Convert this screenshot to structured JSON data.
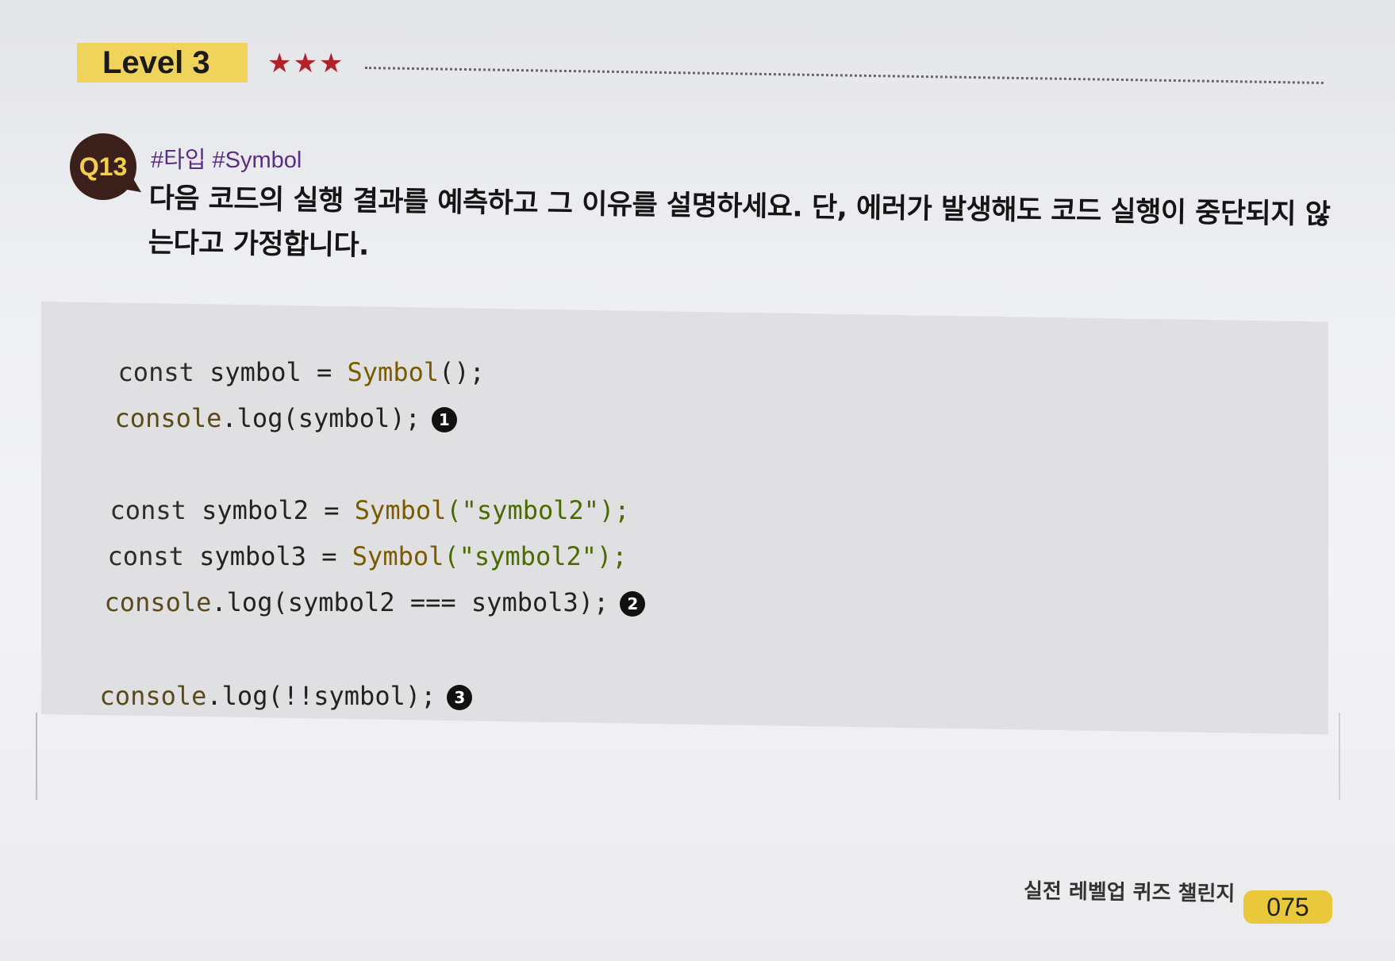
{
  "header": {
    "level_label": "Level 3",
    "stars": "★★★"
  },
  "question": {
    "badge": "Q13",
    "tags": "#타입 #Symbol",
    "text": "다음 코드의 실행 결과를 예측하고 그 이유를 설명하세요. 단, 에러가 발생해도 코드 실행이 중단되지 않는다고 가정합니다."
  },
  "code": {
    "lines": [
      {
        "keyword": "const",
        "name": " symbol = ",
        "func": "Symbol",
        "rest": "();",
        "marker": ""
      },
      {
        "keyword": "",
        "name": "",
        "func": "console",
        "rest": ".log(symbol);",
        "marker": "1"
      },
      {
        "keyword": "const",
        "name": " symbol2 = ",
        "func": "Symbol",
        "rest": "(\"symbol2\");",
        "marker": ""
      },
      {
        "keyword": "const",
        "name": " symbol3 = ",
        "func": "Symbol",
        "rest": "(\"symbol2\");",
        "marker": ""
      },
      {
        "keyword": "",
        "name": "",
        "func": "console",
        "rest": ".log(symbol2 === symbol3);",
        "marker": "2"
      },
      {
        "keyword": "",
        "name": "",
        "func": "console",
        "rest": ".log(!!symbol);",
        "marker": "3"
      }
    ]
  },
  "footer": {
    "book_title": "실전 레벨업 퀴즈 챌린지",
    "page_number": "075"
  }
}
